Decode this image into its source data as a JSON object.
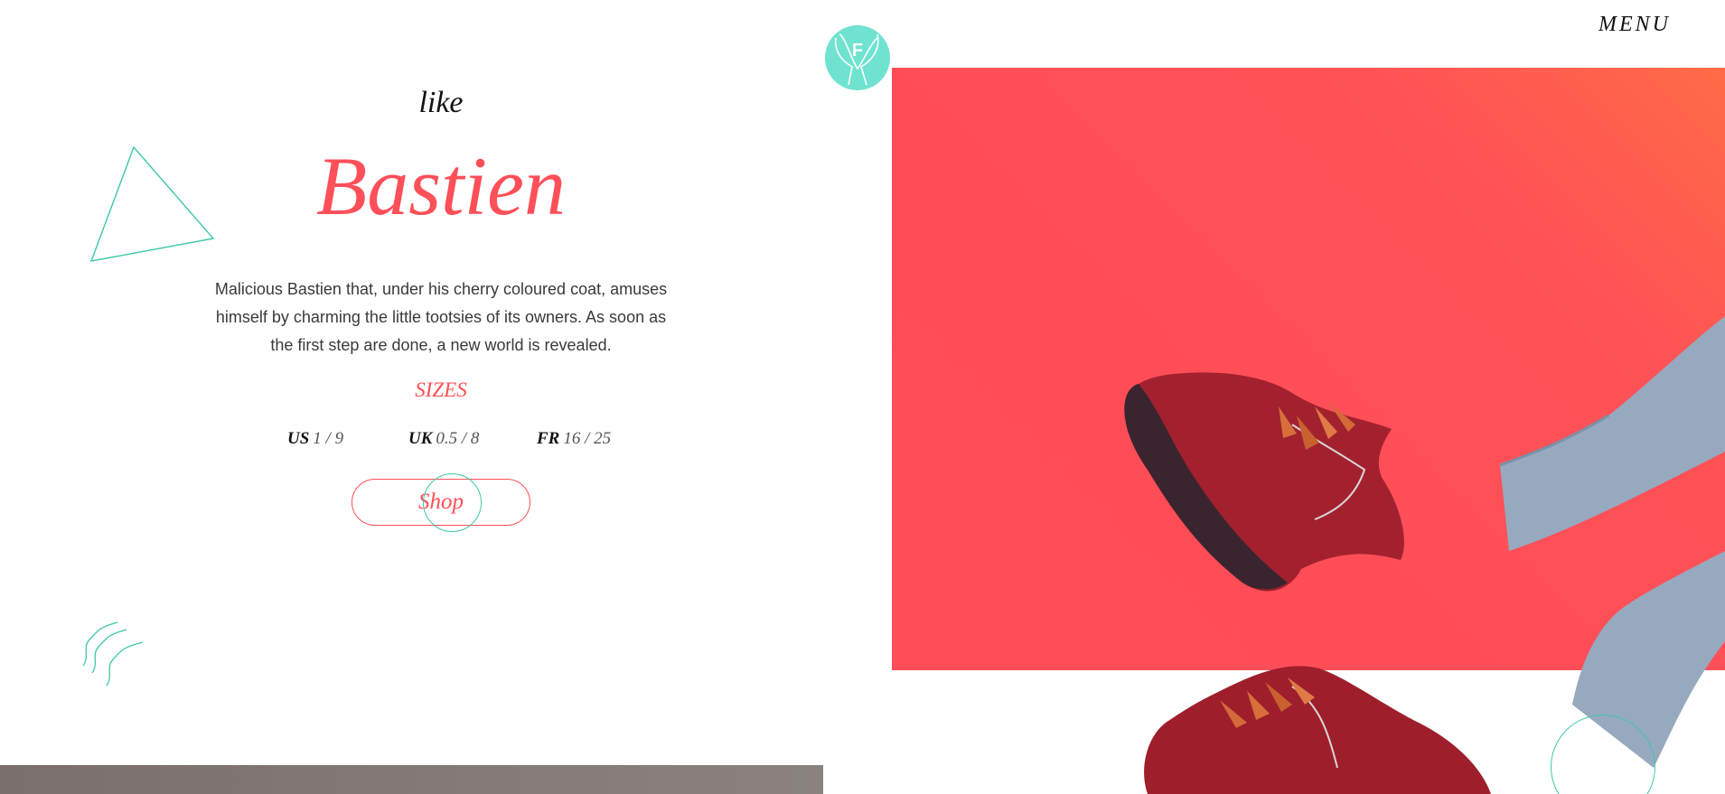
{
  "brand": {
    "logo_letter": "F",
    "accent": "#6fe3cf"
  },
  "header": {
    "menu_label": "MENU"
  },
  "product": {
    "eyebrow": "like",
    "name": "Bastien",
    "description": "Malicious Bastien that, under his cherry coloured coat, amuses himself by charming the little tootsies of its owners. As soon as the first step are done, a new world is revealed.",
    "sizes_label": "SIZES",
    "sizes": [
      {
        "country": "US",
        "range": "1 / 9"
      },
      {
        "country": "UK",
        "range": "0.5 / 8"
      },
      {
        "country": "FR",
        "range": "16 / 25"
      }
    ],
    "shop_label": "Shop"
  },
  "colors": {
    "primary": "#ff4f59",
    "accent": "#3ec8a6",
    "hero_gradient_end": "#ff6b47"
  },
  "icons": [
    "logo-badge",
    "triangle-decoration",
    "wave-decoration",
    "ring-decoration"
  ]
}
